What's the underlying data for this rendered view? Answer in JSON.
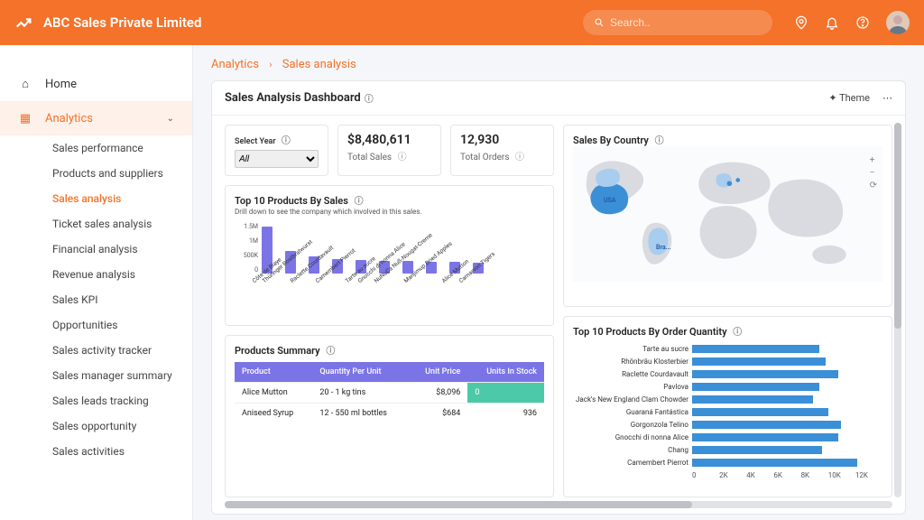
{
  "header": {
    "brand": "ABC Sales Private Limited",
    "search_placeholder": "Search.."
  },
  "sidebar": {
    "home": "Home",
    "analytics": "Analytics",
    "items": [
      "Sales performance",
      "Products and suppliers",
      "Sales analysis",
      "Ticket sales analysis",
      "Financial analysis",
      "Revenue analysis",
      "Sales KPI",
      "Opportunities",
      "Sales activity tracker",
      "Sales manager summary",
      "Sales leads tracking",
      "Sales opportunity",
      "Sales activities"
    ],
    "active_index": 2
  },
  "crumbs": {
    "root": "Analytics",
    "leaf": "Sales analysis"
  },
  "panel": {
    "title": "Sales Analysis Dashboard",
    "theme": "Theme"
  },
  "kpi": {
    "select_label": "Select Year",
    "select_value": "All",
    "total_sales_value": "$8,480,611",
    "total_sales_label": "Total Sales",
    "total_orders_value": "12,930",
    "total_orders_label": "Total Orders"
  },
  "top10sales": {
    "title": "Top 10 Products By Sales",
    "note": "Drill down to see the company which involved in this sales."
  },
  "products_summary": {
    "title": "Products Summary",
    "headers": {
      "product": "Product",
      "qpu": "Quantity Per Unit",
      "price": "Unit Price",
      "stock": "Units In Stock"
    },
    "rows": [
      {
        "product": "Alice Mutton",
        "qpu": "20 - 1 kg tins",
        "price": "$8,096",
        "stock": "0",
        "zero": true
      },
      {
        "product": "Aniseed Syrup",
        "qpu": "12 - 550 ml bottles",
        "price": "$684",
        "stock": "936"
      }
    ]
  },
  "sales_by_country": {
    "title": "Sales By Country",
    "labels": {
      "usa": "USA",
      "bra": "Bra..."
    }
  },
  "top10qty": {
    "title": "Top 10 Products By Order Quantity"
  },
  "chart_data": [
    {
      "type": "bar",
      "title": "Top 10 Products By Sales",
      "yticks": [
        "1.5M",
        "1M",
        "500K",
        "0"
      ],
      "ylim": [
        0,
        1500000
      ],
      "categories": [
        "Côte de Blaye",
        "Thüringer Rostbratwurst",
        "Raclette Courdavault",
        "Camembert Pierrot",
        "Tarte au sucre",
        "Gnocchi di nonna Alice",
        "NuNuCa Nuß-Nougat-Creme",
        "Manjimup Dried Apples",
        "Alice Mutton",
        "Carnarvon Tigers"
      ],
      "values": [
        1450000,
        700000,
        520000,
        450000,
        420000,
        400000,
        380000,
        360000,
        350000,
        340000
      ]
    },
    {
      "type": "bar",
      "orientation": "horizontal",
      "title": "Top 10 Products By Order Quantity",
      "xticks": [
        "0",
        "2K",
        "4K",
        "6K",
        "8K",
        "10K",
        "12K"
      ],
      "xlim": [
        0,
        12000
      ],
      "categories": [
        "Tarte au sucre",
        "Rhönbräu Klosterbier",
        "Raclette Courdavault",
        "Pavlova",
        "Jack's New England Clam Chowder",
        "Guaraná Fantástica",
        "Gorgonzola Telino",
        "Gnocchi di nonna Alice",
        "Chang",
        "Camembert Pierrot"
      ],
      "values": [
        8000,
        8400,
        9200,
        8000,
        7600,
        8600,
        9400,
        9200,
        8200,
        10400
      ]
    },
    {
      "type": "map",
      "title": "Sales By Country",
      "highlighted": [
        "USA",
        "Brazil",
        "Canada",
        "France",
        "Germany"
      ]
    }
  ]
}
